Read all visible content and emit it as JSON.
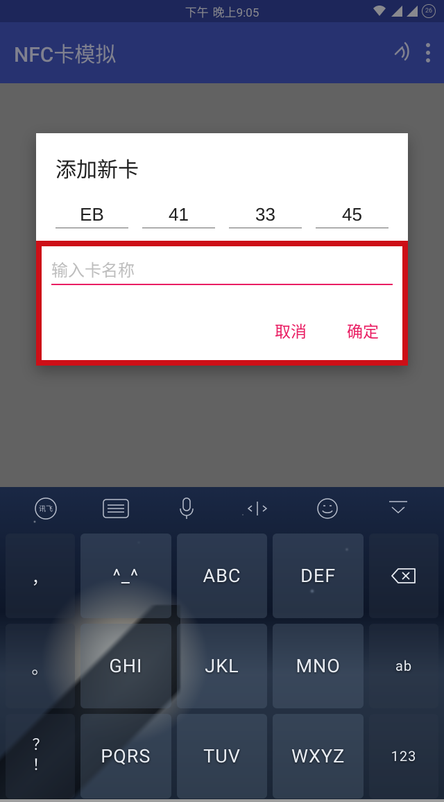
{
  "status_bar": {
    "period": "下午",
    "time": "晚上9:05",
    "battery": "26"
  },
  "app_bar": {
    "title": "NFC卡模拟"
  },
  "dialog": {
    "title": "添加新卡",
    "hex": [
      "EB",
      "41",
      "33",
      "45"
    ],
    "name_placeholder": "输入卡名称",
    "cancel": "取消",
    "confirm": "确定"
  },
  "keyboard": {
    "brand": "讯飞",
    "rows": [
      {
        "side_left": "，",
        "k1": "^_^",
        "k2": "ABC",
        "k3": "DEF",
        "side_right": "backspace"
      },
      {
        "side_left": "。",
        "k1": "GHI",
        "k2": "JKL",
        "k3": "MNO",
        "side_right": "ab"
      },
      {
        "side_left": "？\n！",
        "k1": "PQRS",
        "k2": "TUV",
        "k3": "WXYZ",
        "side_right": "123"
      }
    ]
  }
}
